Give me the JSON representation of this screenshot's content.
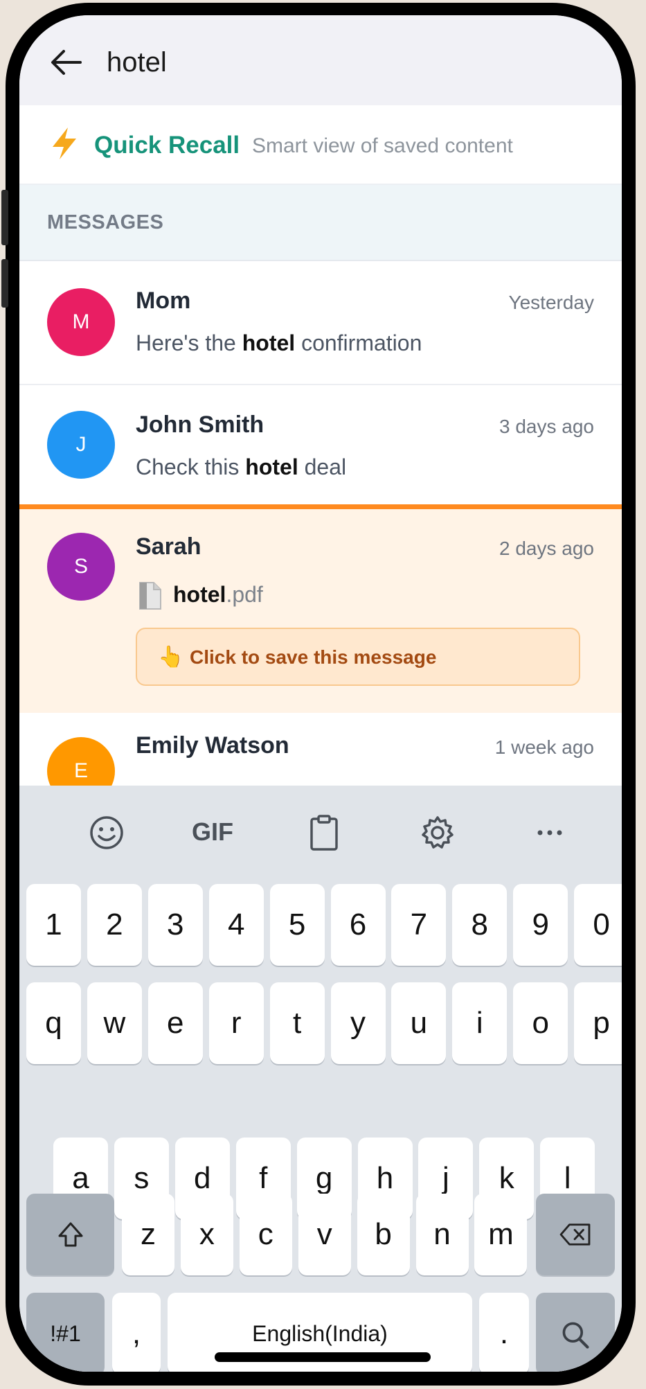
{
  "header": {
    "search_query": "hotel"
  },
  "quick_recall": {
    "title": "Quick Recall",
    "subtitle": "Smart view of saved content"
  },
  "section": {
    "label": "MESSAGES"
  },
  "messages": [
    {
      "initial": "M",
      "color": "#e91e63",
      "sender": "Mom",
      "time": "Yesterday",
      "pre": "Here's the ",
      "match": "hotel",
      "post": " confirmation"
    },
    {
      "initial": "J",
      "color": "#2196f3",
      "sender": "John Smith",
      "time": "3 days ago",
      "pre": "Check this ",
      "match": "hotel",
      "post": " deal"
    },
    {
      "initial": "S",
      "color": "#9c27b0",
      "sender": "Sarah",
      "time": "2 days ago",
      "file_match": "hotel",
      "file_ext": ".pdf",
      "save_label": "Click to save this message"
    },
    {
      "initial": "E",
      "color": "#ff9800",
      "sender": "Emily Watson",
      "time": "1 week ago"
    }
  ],
  "keyboard": {
    "toolbar": {
      "gif": "GIF"
    },
    "row_numbers": [
      "1",
      "2",
      "3",
      "4",
      "5",
      "6",
      "7",
      "8",
      "9",
      "0"
    ],
    "row_1": [
      "q",
      "w",
      "e",
      "r",
      "t",
      "y",
      "u",
      "i",
      "o",
      "p"
    ],
    "row_2": [
      "a",
      "s",
      "d",
      "f",
      "g",
      "h",
      "j",
      "k",
      "l"
    ],
    "row_3": [
      "z",
      "x",
      "c",
      "v",
      "b",
      "n",
      "m"
    ],
    "symbols": "!#1",
    "comma": ",",
    "space": "English(India)",
    "period": "."
  },
  "icons": {
    "back": "arrow-left-icon",
    "bolt": "lightning-bolt-icon",
    "file": "document-icon",
    "hand": "pointing-hand-icon",
    "emoji": "smiley-icon",
    "clipboard": "clipboard-icon",
    "settings": "gear-icon",
    "more": "more-horizontal-icon",
    "shift": "shift-icon",
    "backspace": "backspace-icon",
    "search": "search-icon"
  }
}
